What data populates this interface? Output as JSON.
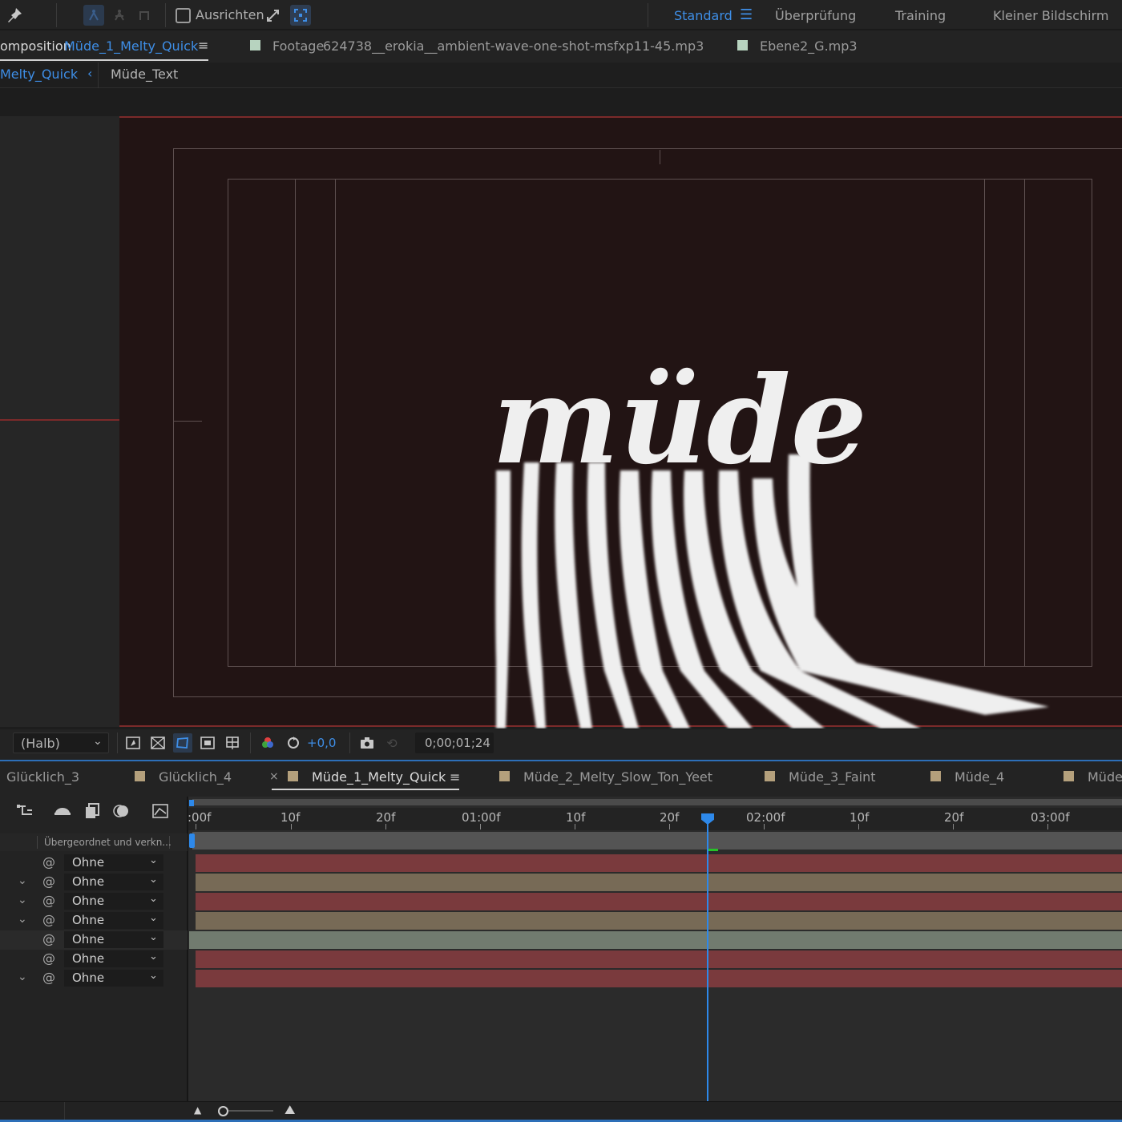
{
  "toolbar": {
    "align_label": "Ausrichten",
    "align_checked": false
  },
  "workspaces": {
    "items": [
      "Standard",
      "Überprüfung",
      "Training",
      "Kleiner Bildschirm"
    ],
    "active": "Standard",
    "menu_icon": "hamburger-icon"
  },
  "panels": {
    "comp_prefix": "omposition",
    "comp_name": "Müde_1_Melty_Quick",
    "footage_prefix": "Footage",
    "footage_name": "624738__erokia__ambient-wave-one-shot-msfxp11-45.mp3",
    "layer_prefix": "Ebene",
    "layer_name": "2_G.mp3"
  },
  "breadcrumb": {
    "current": "Melty_Quick",
    "arrow": "‹",
    "child": "Müde_Text"
  },
  "viewer": {
    "resolution": "(Halb)",
    "exposure": "+0,0",
    "timecode": "0;00;01;24",
    "comp_text": "müde",
    "comp_background": "#221414"
  },
  "timeline_tabs": [
    {
      "label": "Glücklich_3",
      "color": "#b4a07c",
      "swatch": false,
      "active": false
    },
    {
      "label": "Glücklich_4",
      "color": "#b4a07c",
      "swatch": true,
      "active": false
    },
    {
      "label": "Müde_1_Melty_Quick",
      "color": "#b4a07c",
      "swatch": true,
      "active": true
    },
    {
      "label": "Müde_2_Melty_Slow_Ton_Yeet",
      "color": "#b4a07c",
      "swatch": true,
      "active": false
    },
    {
      "label": "Müde_3_Faint",
      "color": "#b4a07c",
      "swatch": true,
      "active": false
    },
    {
      "label": "Müde_4",
      "color": "#b4a07c",
      "swatch": true,
      "active": false
    },
    {
      "label": "Müde",
      "color": "#b4a07c",
      "swatch": true,
      "active": false
    }
  ],
  "timeline": {
    "close_icon": "×",
    "menu_icon": "≡",
    "parent_column_header": "Übergeordnet und verkn...",
    "ruler_labels": [
      ":00f",
      "10f",
      "20f",
      "01:00f",
      "10f",
      "20f",
      "02:00f",
      "10f",
      "20f",
      "03:00f"
    ],
    "playhead_time": "0;00;01;24",
    "layers": [
      {
        "parent": "Ohne",
        "expandable": false,
        "bar_color": "#7a3a3d"
      },
      {
        "parent": "Ohne",
        "expandable": true,
        "bar_color": "#776a56"
      },
      {
        "parent": "Ohne",
        "expandable": true,
        "bar_color": "#7a3a3d"
      },
      {
        "parent": "Ohne",
        "expandable": true,
        "bar_color": "#776a56"
      },
      {
        "parent": "Ohne",
        "expandable": false,
        "bar_color": "#717b6f"
      },
      {
        "parent": "Ohne",
        "expandable": false,
        "bar_color": "#7a3a3d"
      },
      {
        "parent": "Ohne",
        "expandable": true,
        "bar_color": "#7a3a3d"
      }
    ]
  },
  "colors": {
    "accent": "#2e89ea",
    "swatch_comp": "#b4a07c",
    "swatch_footage": "#b7d3bf"
  }
}
